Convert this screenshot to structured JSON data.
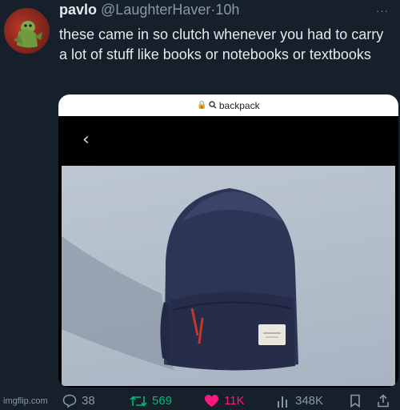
{
  "tweet": {
    "display_name": "pavlo",
    "handle": "@LaughterHaver",
    "separator": "·",
    "time": "10h",
    "more": "···",
    "text": "these came in so clutch whenever you had to carry a lot of stuff like books or notebooks or textbooks"
  },
  "embed": {
    "url_text": "backpack",
    "back_icon": "chevron-left-icon"
  },
  "actions": {
    "replies": "38",
    "retweets": "569",
    "likes": "11K",
    "views": "348K"
  },
  "watermark": "imgflip.com",
  "colors": {
    "background": "#15202b",
    "retweet": "#00ba7c",
    "like": "#f91880",
    "muted": "#8b98a5"
  }
}
